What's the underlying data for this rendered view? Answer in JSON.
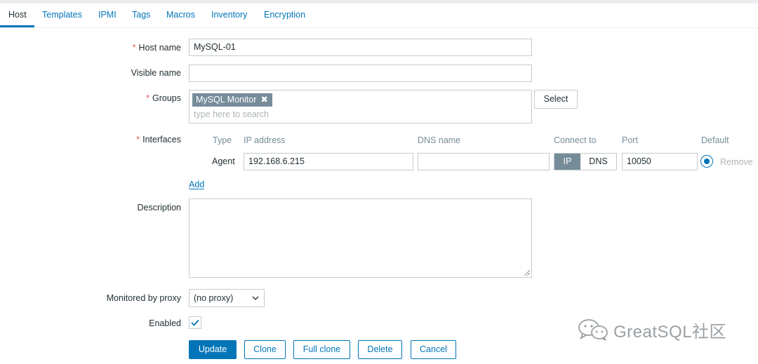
{
  "tabs": [
    {
      "label": "Host",
      "active": true
    },
    {
      "label": "Templates"
    },
    {
      "label": "IPMI"
    },
    {
      "label": "Tags"
    },
    {
      "label": "Macros"
    },
    {
      "label": "Inventory"
    },
    {
      "label": "Encryption"
    }
  ],
  "form": {
    "required_mark": "*",
    "host_name": {
      "label": "Host name",
      "value": "MySQL-01"
    },
    "visible_name": {
      "label": "Visible name",
      "value": ""
    },
    "groups": {
      "label": "Groups",
      "chips": [
        "MySQL Monitor"
      ],
      "placeholder": "type here to search",
      "select_button": "Select"
    },
    "interfaces": {
      "label": "Interfaces",
      "columns": {
        "type": "Type",
        "ip": "IP address",
        "dns": "DNS name",
        "connect": "Connect to",
        "port": "Port",
        "default": "Default"
      },
      "rows": [
        {
          "type": "Agent",
          "ip": "192.168.6.215",
          "dns": "",
          "connect_ip": "IP",
          "connect_dns": "DNS",
          "port": "10050",
          "remove": "Remove"
        }
      ],
      "add_link": "Add"
    },
    "description": {
      "label": "Description",
      "value": ""
    },
    "proxy": {
      "label": "Monitored by proxy",
      "value": "(no proxy)"
    },
    "enabled": {
      "label": "Enabled",
      "checked": true
    }
  },
  "buttons": {
    "update": "Update",
    "clone": "Clone",
    "full_clone": "Full clone",
    "delete": "Delete",
    "cancel": "Cancel"
  },
  "watermark": {
    "text": "GreatSQL社区"
  },
  "colors": {
    "link": "#0275b8",
    "required": "#e45959",
    "chip": "#768d99",
    "text": "#1f2c33"
  }
}
